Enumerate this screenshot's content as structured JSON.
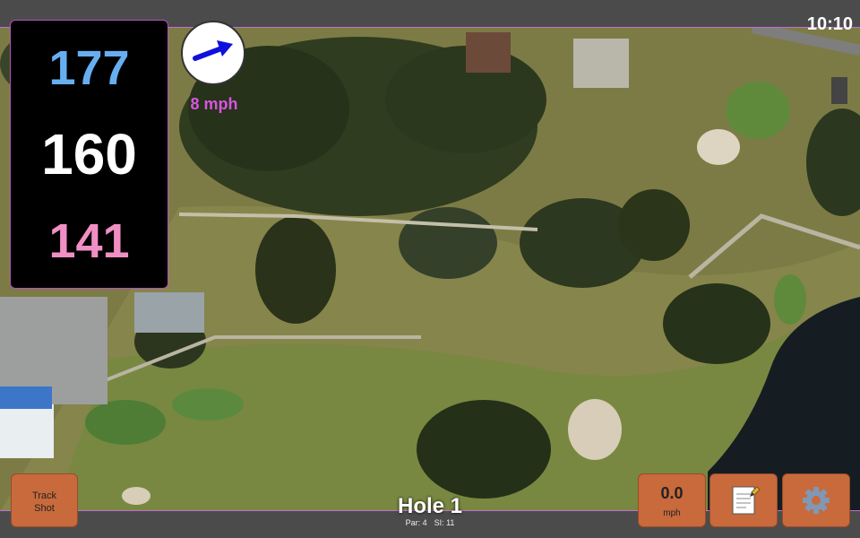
{
  "status": {
    "time": "10:10"
  },
  "distances": {
    "back": "177",
    "middle": "160",
    "front": "141"
  },
  "wind": {
    "speed": "8 mph",
    "icon": "wind-direction-arrow-icon"
  },
  "buttons": {
    "track_shot": {
      "line1": "Track",
      "line2": "Shot"
    },
    "speed": {
      "value": "0.0",
      "unit": "mph"
    },
    "notes_icon": "notepad-icon",
    "settings_icon": "gear-icon"
  },
  "hole": {
    "title": "Hole 1",
    "par": "Par: 4",
    "si": "SI: 11"
  },
  "colors": {
    "back": "#66aef0",
    "middle": "#ffffff",
    "front": "#f08fc4",
    "wind_text": "#d955df",
    "button": "#c86a3c"
  }
}
